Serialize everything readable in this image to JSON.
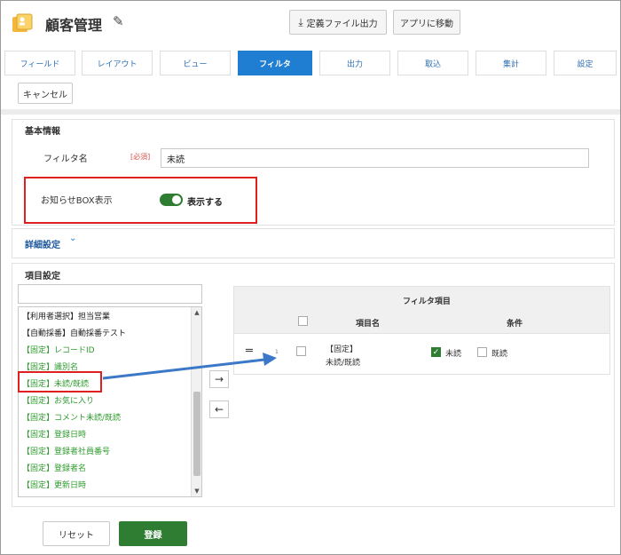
{
  "app": {
    "title": "顧客管理"
  },
  "header": {
    "export_label": "定義ファイル出力",
    "move_label": "アプリに移動"
  },
  "tabs": [
    {
      "label": "フィールド"
    },
    {
      "label": "レイアウト"
    },
    {
      "label": "ビュー"
    },
    {
      "label": "フィルタ"
    },
    {
      "label": "出力"
    },
    {
      "label": "取込"
    },
    {
      "label": "集計"
    },
    {
      "label": "設定"
    }
  ],
  "active_tab": "フィルタ",
  "toolbar": {
    "cancel_label": "キャンセル"
  },
  "basic": {
    "title": "基本情報",
    "filter_name_label": "フィルタ名",
    "required_label": "[必須]",
    "filter_name_value": "未読",
    "notice_label": "お知らせBOX表示",
    "toggle_label": "表示する"
  },
  "detail": {
    "title": "詳細設定"
  },
  "items": {
    "title": "項目設定",
    "search_value": "",
    "list": [
      {
        "label": "【利用者選択】担当営業",
        "color": "black"
      },
      {
        "label": "【自動採番】自動採番テスト",
        "color": "black"
      },
      {
        "label": "【固定】レコードID",
        "color": "green"
      },
      {
        "label": "【固定】識別名",
        "color": "green"
      },
      {
        "label": "【固定】未読/既読",
        "color": "green"
      },
      {
        "label": "【固定】お気に入り",
        "color": "green"
      },
      {
        "label": "【固定】コメント未読/既読",
        "color": "green"
      },
      {
        "label": "【固定】登録日時",
        "color": "green"
      },
      {
        "label": "【固定】登録者社員番号",
        "color": "green"
      },
      {
        "label": "【固定】登録者名",
        "color": "green"
      },
      {
        "label": "【固定】更新日時",
        "color": "green"
      }
    ],
    "add_arrow": "→",
    "remove_arrow": "←"
  },
  "filter_table": {
    "title": "フィルタ項目",
    "col_name": "項目名",
    "col_condition": "条件",
    "rows": [
      {
        "handle": "═",
        "no": "1",
        "name_line1": "【固定】",
        "name_line2": "未読/既読",
        "opt1": "未読",
        "opt1_checked": true,
        "opt2": "既読",
        "opt2_checked": false
      }
    ]
  },
  "footer": {
    "reset_label": "リセット",
    "register_label": "登録"
  },
  "colors": {
    "accent": "#1f7dd2",
    "green": "#2e7d32",
    "highlight": "#e02020",
    "arrow": "#3b78c8"
  }
}
